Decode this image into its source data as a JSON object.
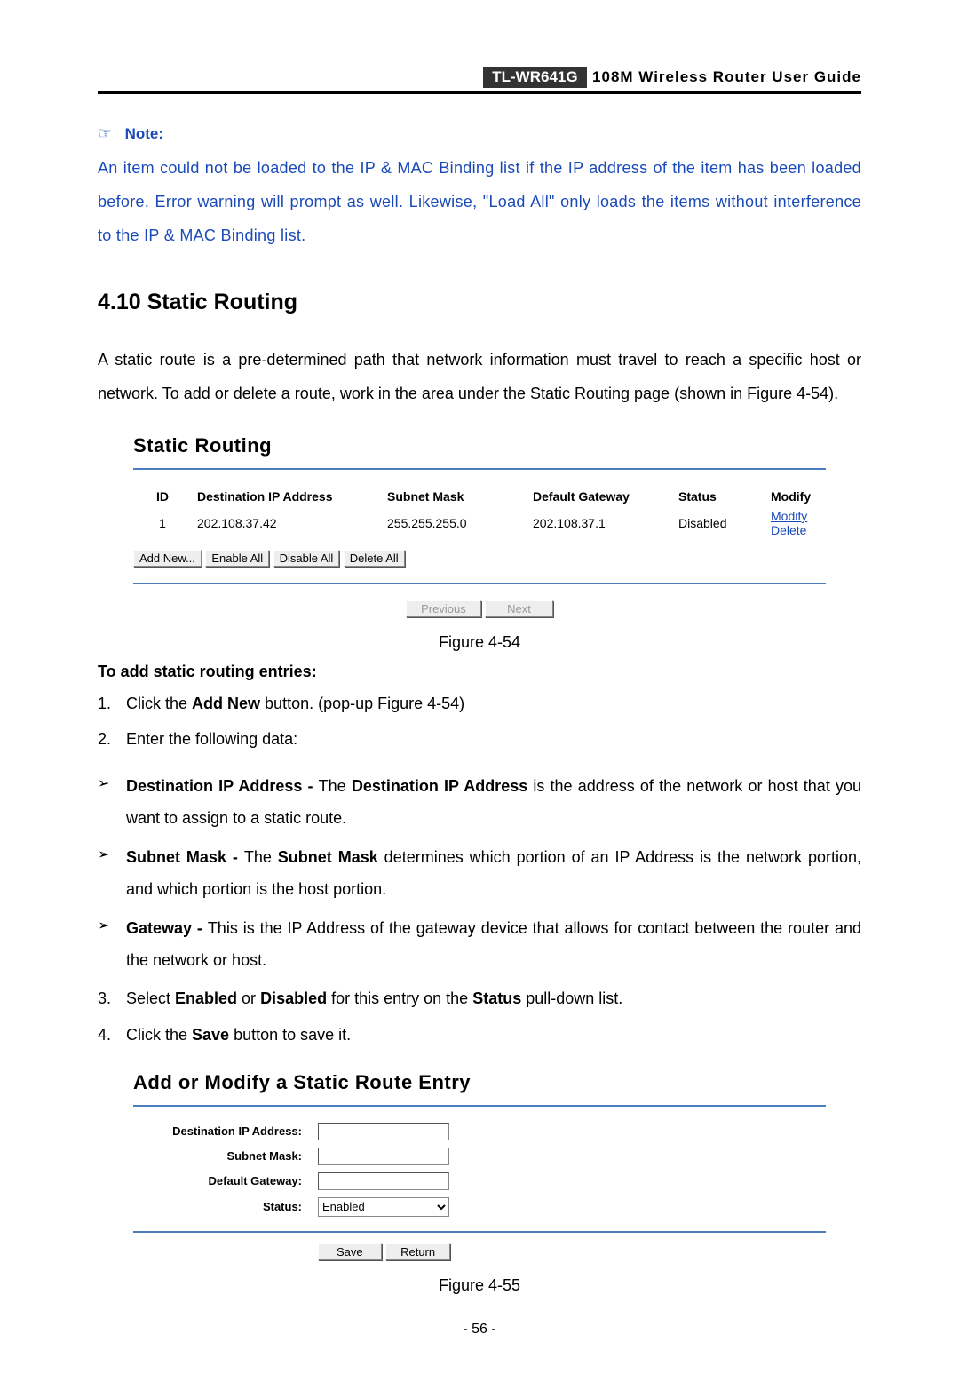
{
  "header": {
    "model": "TL-WR641G",
    "title": "108M  Wireless  Router  User  Guide"
  },
  "note": {
    "label": "Note:",
    "text": "An item could not be loaded to the IP & MAC Binding list if the IP address of the item has been loaded before. Error warning will prompt as well. Likewise, \"Load All\" only loads the items without interference to the IP & MAC Binding list."
  },
  "section": {
    "heading": "4.10  Static Routing",
    "intro": "A static route is a pre-determined path that network information must travel to reach a specific host or network. To add or delete a route, work in the area under the Static Routing page (shown in Figure 4-54)."
  },
  "figure54": {
    "panel_title": "Static Routing",
    "columns": [
      "ID",
      "Destination IP Address",
      "Subnet Mask",
      "Default Gateway",
      "Status",
      "Modify"
    ],
    "rows": [
      {
        "id": "1",
        "dest": "202.108.37.42",
        "mask": "255.255.255.0",
        "gateway": "202.108.37.1",
        "status": "Disabled",
        "modify": "Modify",
        "delete": "Delete"
      }
    ],
    "buttons": {
      "add": "Add New...",
      "enable": "Enable All",
      "disable": "Disable All",
      "delete": "Delete All",
      "prev": "Previous",
      "next": "Next"
    },
    "caption": "Figure 4-54"
  },
  "instructions": {
    "heading": "To add static routing entries:",
    "step1_pre": "Click the ",
    "step1_bold": "Add New",
    "step1_post": " button. (pop-up Figure 4-54)",
    "step2": "Enter the following data:",
    "dest_label": "Destination IP Address - ",
    "dest_mid": "The ",
    "dest_bold": "Destination IP Address",
    "dest_text": " is the address of the network or host that you want to assign to a static route.",
    "mask_label": "Subnet Mask - ",
    "mask_mid": "The ",
    "mask_bold": "Subnet Mask",
    "mask_text": " determines which portion of an IP Address is the network portion, and which portion is the host portion.",
    "gw_label": "Gateway - ",
    "gw_text": "This is the IP Address of the gateway device that allows for contact between the router and the network or host.",
    "step3_pre": "Select ",
    "step3_en": "Enabled",
    "step3_or": " or ",
    "step3_dis": "Disabled",
    "step3_mid": " for this entry on the ",
    "step3_status": "Status",
    "step3_post": " pull-down list.",
    "step4_pre": "Click the ",
    "step4_bold": "Save",
    "step4_post": " button to save it."
  },
  "figure55": {
    "panel_title": "Add or Modify a Static Route Entry",
    "labels": {
      "dest": "Destination IP Address:",
      "mask": "Subnet Mask:",
      "gateway": "Default Gateway:",
      "status": "Status:"
    },
    "status_selected": "Enabled",
    "buttons": {
      "save": "Save",
      "return": "Return"
    },
    "caption": "Figure 4-55"
  },
  "page_number": "- 56 -"
}
